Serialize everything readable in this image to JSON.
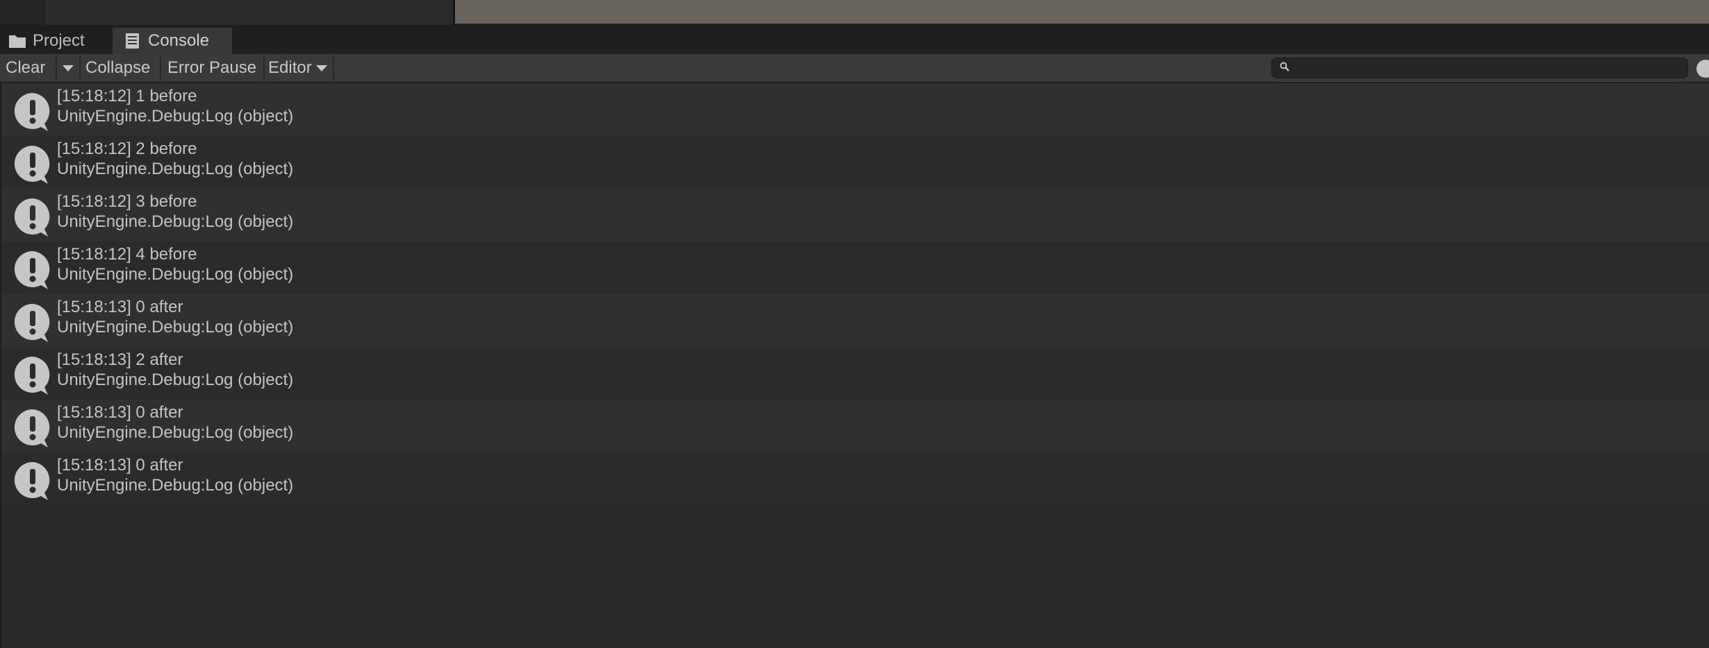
{
  "tabs": [
    {
      "label": "Project",
      "icon": "folder-icon",
      "active": false
    },
    {
      "label": "Console",
      "icon": "console-icon",
      "active": true
    }
  ],
  "toolbar": {
    "clear_label": "Clear",
    "collapse_label": "Collapse",
    "error_pause_label": "Error Pause",
    "editor_label": "Editor"
  },
  "search": {
    "value": "",
    "placeholder": ""
  },
  "colors": {
    "background": "#282828",
    "row_even": "#303030",
    "row_odd": "#2b2b2b",
    "toolbar": "#3a3a3a",
    "active_tab": "#383838",
    "text": "#c4c4c4",
    "scene_view": "#6b655f"
  },
  "logs": [
    {
      "message": "[15:18:12] 1 before",
      "stacktrace": "UnityEngine.Debug:Log (object)",
      "icon": "info-log-icon"
    },
    {
      "message": "[15:18:12] 2 before",
      "stacktrace": "UnityEngine.Debug:Log (object)",
      "icon": "info-log-icon"
    },
    {
      "message": "[15:18:12] 3 before",
      "stacktrace": "UnityEngine.Debug:Log (object)",
      "icon": "info-log-icon"
    },
    {
      "message": "[15:18:12] 4 before",
      "stacktrace": "UnityEngine.Debug:Log (object)",
      "icon": "info-log-icon"
    },
    {
      "message": "[15:18:13] 0 after",
      "stacktrace": "UnityEngine.Debug:Log (object)",
      "icon": "info-log-icon"
    },
    {
      "message": "[15:18:13] 2 after",
      "stacktrace": "UnityEngine.Debug:Log (object)",
      "icon": "info-log-icon"
    },
    {
      "message": "[15:18:13] 0 after",
      "stacktrace": "UnityEngine.Debug:Log (object)",
      "icon": "info-log-icon"
    },
    {
      "message": "[15:18:13] 0 after",
      "stacktrace": "UnityEngine.Debug:Log (object)",
      "icon": "info-log-icon"
    }
  ]
}
